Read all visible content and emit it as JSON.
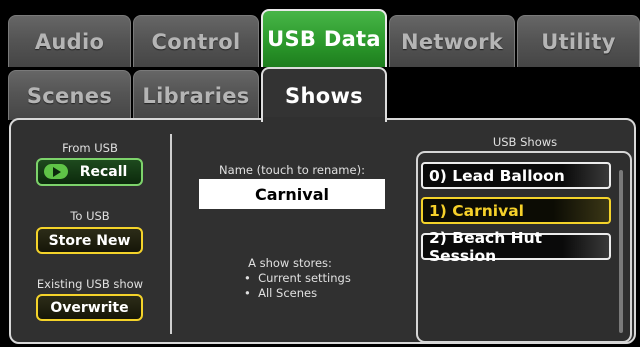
{
  "tabs_row1": [
    {
      "label": "Audio"
    },
    {
      "label": "Control"
    },
    {
      "label": "USB Data"
    },
    {
      "label": "Network"
    },
    {
      "label": "Utility"
    }
  ],
  "tabs_row2": [
    {
      "label": "Scenes"
    },
    {
      "label": "Libraries"
    },
    {
      "label": "Shows"
    }
  ],
  "left": {
    "from_usb_label": "From USB",
    "recall_label": "Recall",
    "to_usb_label": "To USB",
    "store_new_label": "Store New",
    "existing_label": "Existing USB show",
    "overwrite_label": "Overwrite"
  },
  "middle": {
    "name_label": "Name (touch to rename):",
    "name_value": "Carnival",
    "stores_heading": "A show stores:",
    "stores_items": [
      "Current settings",
      "All Scenes"
    ]
  },
  "right": {
    "title": "USB Shows",
    "items": [
      {
        "label": "0) Lead Balloon",
        "selected": false
      },
      {
        "label": "1) Carnival",
        "selected": true
      },
      {
        "label": "2) Beach Hut Session",
        "selected": false
      }
    ]
  },
  "colors": {
    "active_tab_green": "#2c9a2c",
    "recall_green": "#7dd36b",
    "highlight_yellow": "#f4d32a",
    "panel_bg": "#303030"
  }
}
